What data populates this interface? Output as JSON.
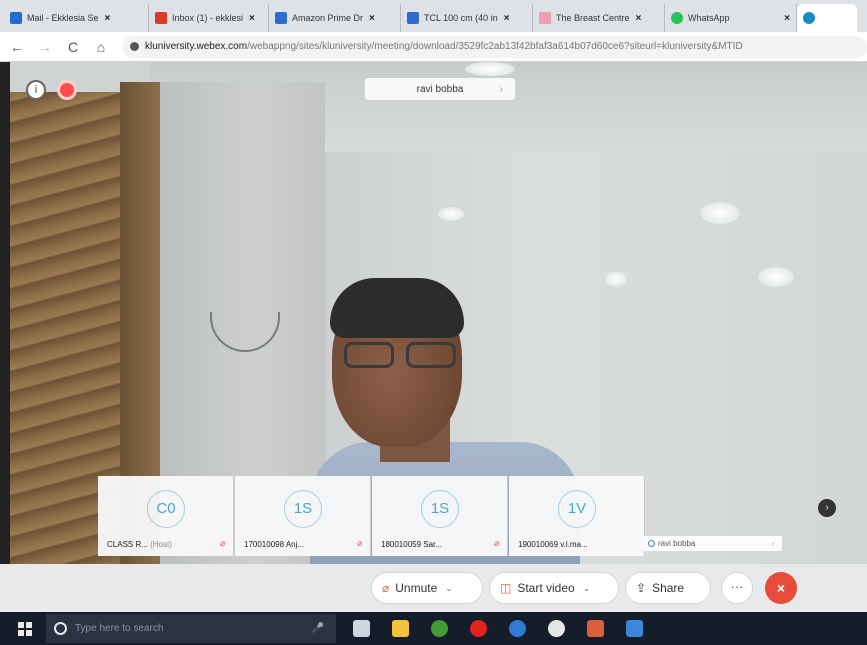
{
  "browser": {
    "tabs": [
      {
        "title": "Mail - Ekklesia Se",
        "favicon_color": "#1e6fd1",
        "active": false
      },
      {
        "title": "Inbox (1) - ekklesi",
        "favicon_color": "#d93b2b",
        "active": false
      },
      {
        "title": "Amazon Prime Dr",
        "favicon_color": "#2f6ad0",
        "active": false
      },
      {
        "title": "TCL 100 cm (40 in",
        "favicon_color": "#2f6ad0",
        "active": false
      },
      {
        "title": "The Breast Centre",
        "favicon_color": "#f29bb0",
        "active": false
      },
      {
        "title": "WhatsApp",
        "favicon_color": "#25c35b",
        "active": false
      },
      {
        "title": "",
        "favicon_color": "#1a8bbf",
        "active": true
      }
    ],
    "close_glyph": "×",
    "nav": {
      "back": "←",
      "forward": "→",
      "reload": "C",
      "home": "⌂"
    },
    "url_host": "kluniversity.webex.com",
    "url_path": "/webappng/sites/kluniversity/meeting/download/3529fc2ab13f42bfaf3a614b07d60ce6?siteurl=kluniversity&MTID"
  },
  "meeting": {
    "active_speaker": "ravi bobba",
    "info_glyph": "i",
    "participants": [
      {
        "initials": "C0",
        "name": "CLASS R...",
        "role": "(Host)"
      },
      {
        "initials": "1S",
        "name": "170010098 Anj...",
        "role": ""
      },
      {
        "initials": "1S",
        "name": "180010059 Sar...",
        "role": ""
      },
      {
        "initials": "1V",
        "name": "190010069 v.l.ma...",
        "role": ""
      }
    ],
    "self_label": "ravi bobba",
    "mic_muted_glyph": "⌀",
    "chevron_right": "›",
    "next_glyph": "›"
  },
  "controls": {
    "unmute": "Unmute",
    "start_video": "Start video",
    "share": "Share",
    "more": "···",
    "end": "×",
    "dropdown_glyph": "⌄",
    "accent": "#e64b3b"
  },
  "taskbar": {
    "search_placeholder": "Type here to search",
    "apps": [
      {
        "name": "task-view",
        "color": "#cfd6df"
      },
      {
        "name": "file-explorer",
        "color": "#f2c23e"
      },
      {
        "name": "chrome",
        "color": "#3f9c35"
      },
      {
        "name": "opera",
        "color": "#e2241a"
      },
      {
        "name": "edge",
        "color": "#2f7bd4"
      },
      {
        "name": "settings",
        "color": "#e6e6e6"
      },
      {
        "name": "calendar-app",
        "color": "#d9613f"
      },
      {
        "name": "photos-app",
        "color": "#3d86d8"
      }
    ]
  }
}
